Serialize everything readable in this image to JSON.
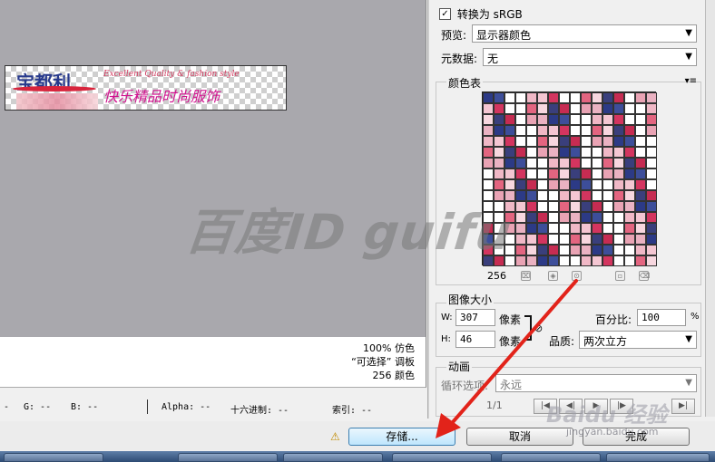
{
  "preview": {
    "logo_text": "宝都利",
    "slogan_en": "Excellent Quality & fashion style",
    "slogan_cn": "快乐精品时尚服饰"
  },
  "info": {
    "dither": "100% 仿色",
    "palette": "“可选择” 调板",
    "colors": "256 颜色"
  },
  "status": {
    "r": "-",
    "g": "G: --",
    "b": "B: --",
    "alpha": "Alpha: --",
    "hex": "十六进制: --",
    "index": "索引: --"
  },
  "settings": {
    "convert_srgb_checked": true,
    "convert_srgb_label": "转换为 sRGB",
    "preview_label": "预览:",
    "preview_value": "显示器颜色",
    "metadata_label": "元数据:",
    "metadata_value": "无"
  },
  "color_table": {
    "title": "颜色表",
    "count": "256",
    "menu_glyph": "▾≡"
  },
  "image_size": {
    "title": "图像大小",
    "w_label": "W:",
    "w_value": "307",
    "h_label": "H:",
    "h_value": "46",
    "unit": "像素",
    "percent_label": "百分比:",
    "percent_value": "100",
    "percent_unit": "%",
    "quality_label": "品质:",
    "quality_value": "两次立方"
  },
  "animation": {
    "title": "动画",
    "loop_label": "循环选项:",
    "loop_value": "永远",
    "frame_counter": "1/1"
  },
  "buttons": {
    "save": "存储...",
    "cancel": "取消",
    "done": "完成"
  },
  "watermarks": {
    "center": "百度ID guifu",
    "baidu": "Baidu 经验",
    "url": "jingyan.baidu.com"
  },
  "colors": {
    "accent_arrow": "#e2231a",
    "save_border": "#3c7fb1"
  },
  "palette_colors": [
    "#2c3a86",
    "#ffffff",
    "#e9a3b4",
    "#f4c6d2",
    "#c62c52",
    "#ffffff",
    "#f7d7df",
    "#3d4e9a",
    "#ffffff",
    "#eab2c2",
    "#d3355f",
    "#ffffff",
    "#f0b8c6",
    "#3a3f7c",
    "#ffffff",
    "#e36580"
  ]
}
